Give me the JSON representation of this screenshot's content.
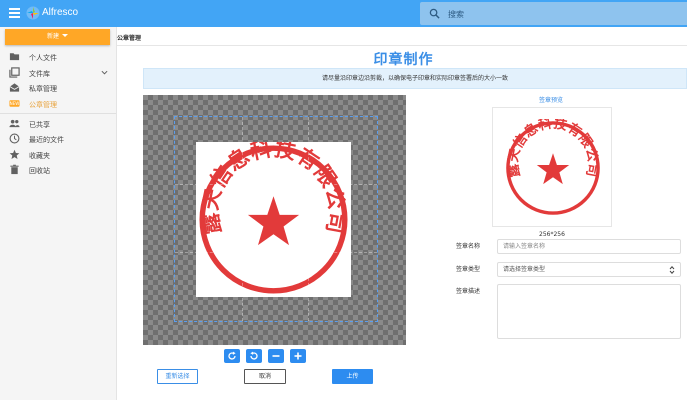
{
  "app": {
    "brand": "Alfresco",
    "accent": "#42a5f5"
  },
  "search": {
    "placeholder": "搜索"
  },
  "sidebar": {
    "new_button": "新建",
    "items": [
      {
        "label": "个人文件",
        "icon": "folder-icon"
      },
      {
        "label": "文件库",
        "icon": "library-icon"
      },
      {
        "label": "私章管理",
        "icon": "inbox-icon"
      },
      {
        "label": "公章管理",
        "icon": "new-badge-icon"
      },
      {
        "label": "已共享",
        "icon": "people-icon"
      },
      {
        "label": "最近的文件",
        "icon": "clock-icon"
      },
      {
        "label": "收藏夹",
        "icon": "star-icon"
      },
      {
        "label": "回收站",
        "icon": "trash-icon"
      }
    ]
  },
  "breadcrumb": {
    "current": "公章管理"
  },
  "main": {
    "title": "印章制作",
    "notice": "请尽量沿印章边沿剪裁，以确保电子印章和实际印章签署后的大小一致"
  },
  "seal": {
    "text": "露天信息科技有限公司",
    "color": "#e23a3a"
  },
  "preview": {
    "label": "签章预览",
    "size": "256*256"
  },
  "form": {
    "name_label": "签章名称",
    "name_placeholder": "请输入签章名称",
    "type_label": "签章类型",
    "type_placeholder": "请选择签章类型",
    "desc_label": "签章描述"
  },
  "actions": {
    "reselect": "重新选择",
    "cancel": "取消",
    "upload": "上传"
  }
}
